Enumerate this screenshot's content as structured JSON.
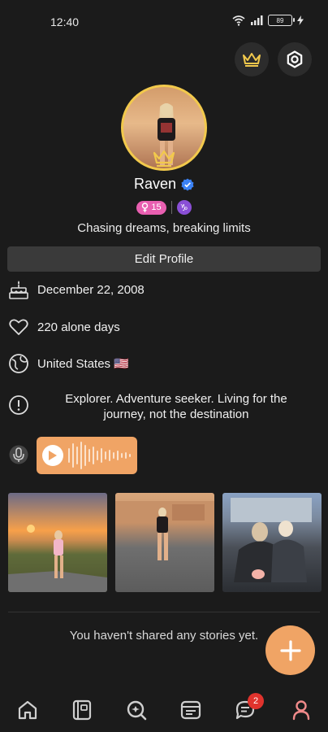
{
  "status_bar": {
    "time": "12:40",
    "battery": "89"
  },
  "profile": {
    "name": "Raven",
    "level": "15",
    "bio": "Chasing dreams, breaking limits",
    "edit_label": "Edit Profile"
  },
  "info": {
    "birthday": "December 22, 2008",
    "alone_days": "220 alone days",
    "country": "United States 🇺🇸",
    "about": "Explorer. Adventure seeker. Living for the journey, not the destination"
  },
  "stories": {
    "empty_text": "You haven't shared any stories yet."
  },
  "nav": {
    "messages_badge": "2"
  },
  "colors": {
    "accent": "#f0a465",
    "gold": "#f2c94c",
    "verified": "#3b82f6",
    "pink": "#e85fb0",
    "purple": "#8a4fd6",
    "nav_active": "#f08a8a"
  },
  "icons": [
    "crown-icon",
    "settings-icon",
    "verified-icon",
    "cake-icon",
    "heart-icon",
    "globe-icon",
    "info-icon",
    "microphone-icon",
    "play-icon",
    "plus-icon",
    "home-icon",
    "book-icon",
    "search-icon",
    "feed-icon",
    "chat-icon",
    "profile-icon"
  ]
}
